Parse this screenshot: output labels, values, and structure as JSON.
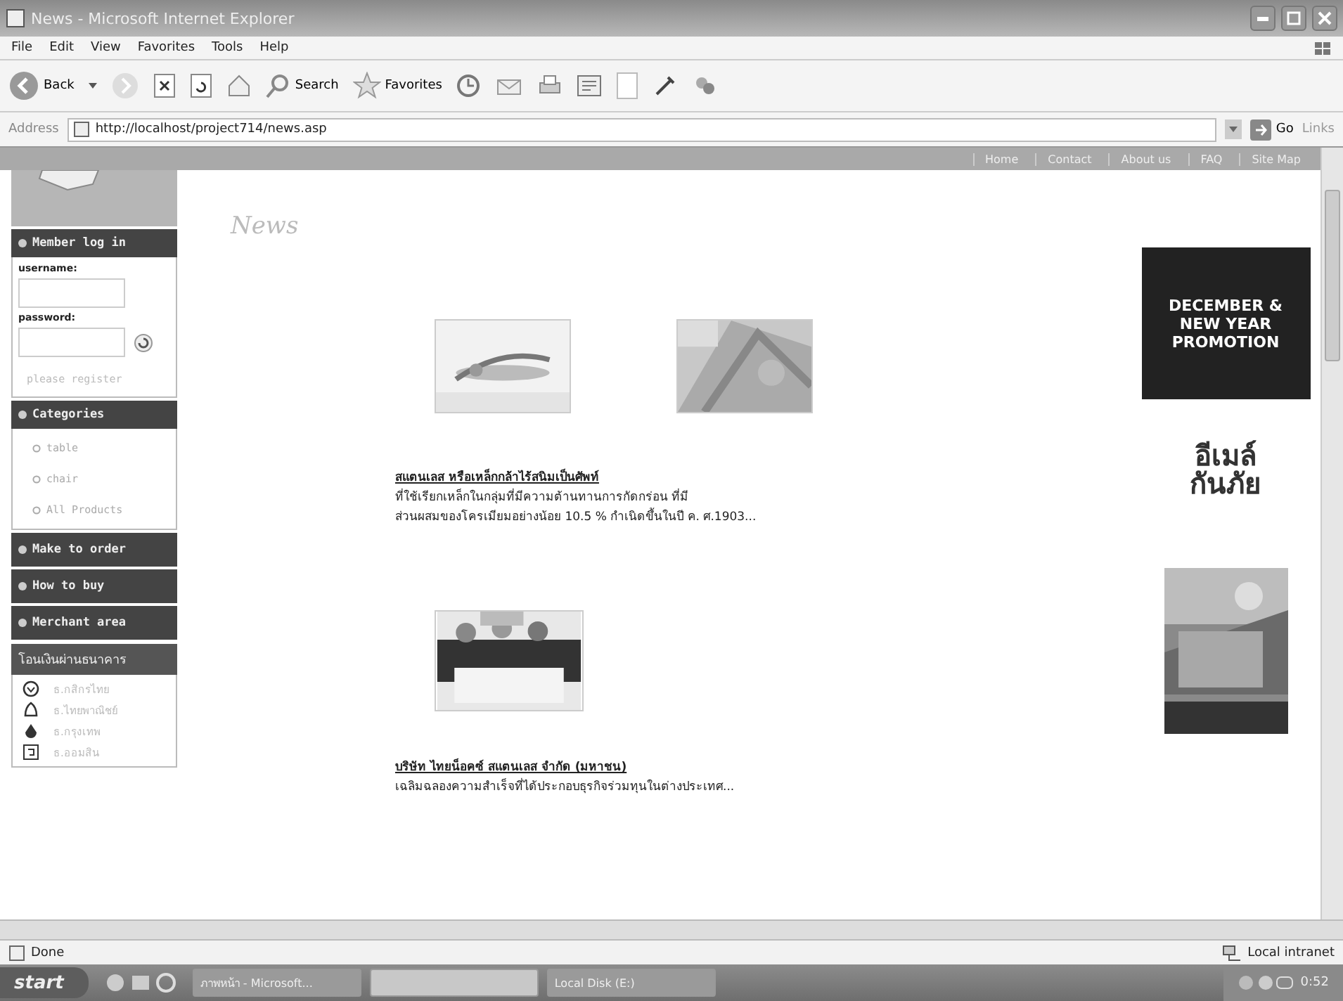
{
  "window": {
    "title": "News - Microsoft Internet Explorer"
  },
  "menu": [
    "File",
    "Edit",
    "View",
    "Favorites",
    "Tools",
    "Help"
  ],
  "toolbar": {
    "back": "Back",
    "search": "Search",
    "favorites": "Favorites"
  },
  "address": {
    "label": "Address",
    "url": "http://localhost/project714/news.asp",
    "go": "Go",
    "links": "Links"
  },
  "site_nav": [
    "Home",
    "Contact",
    "About us",
    "FAQ",
    "Site Map"
  ],
  "login": {
    "title": "Member log in",
    "username_label": "username:",
    "password_label": "password:",
    "register": "please register"
  },
  "categories": {
    "title": "Categories",
    "items": [
      "table",
      "chair",
      "All Products"
    ]
  },
  "menu_blocks": [
    "Make to order",
    "How to buy",
    "Merchant area"
  ],
  "bank": {
    "title": "โอนเงินผ่านธนาคาร",
    "items": [
      {
        "kind": "ring",
        "label": "ธ.กสิกรไทย"
      },
      {
        "kind": "bell",
        "label": "ธ.ไทยพาณิชย์"
      },
      {
        "kind": "drop",
        "label": "ธ.กรุงเทพ"
      },
      {
        "kind": "square",
        "label": "ธ.ออมสิน"
      }
    ]
  },
  "page_title": "News",
  "news": [
    {
      "photos": [
        {
          "kind": "picture"
        },
        {
          "kind": "picture"
        }
      ],
      "headline": "สแตนเลส หรือเหล็กกล้าไร้สนิมเป็นศัพท์",
      "lines": [
        "ที่ใช้เรียกเหล็กในกลุ่มที่มีความต้านทานการกัดกร่อน ที่มี",
        "ส่วนผสมของโครเมียมอย่างน้อย 10.5 % กำเนิดขึ้นในปี ค. ศ.1903..."
      ]
    },
    {
      "photos": [
        {
          "kind": "picture"
        }
      ],
      "headline": "บริษัท ไทยน็อคซ์ สแตนเลส จำกัด (มหาชน)",
      "lines": [
        "เฉลิมฉลองความสำเร็จที่ได้ประกอบธุรกิจร่วมทุนในต่างประเทศ..."
      ]
    }
  ],
  "ads": [
    {
      "kind": "promotion",
      "lines": [
        "DECEMBER &",
        "NEW YEAR",
        "PROMOTION"
      ]
    },
    {
      "kind": "logo",
      "lines": [
        "อีเมล์",
        "กันภัย"
      ]
    },
    {
      "kind": "picture"
    }
  ],
  "status_bar": {
    "text": "Done",
    "zone": "Local intranet"
  },
  "taskbar": {
    "start": "start",
    "tasks": [
      {
        "label": "ภาพหน้า - Microsoft...",
        "selected": false
      },
      {
        "selected": true
      },
      {
        "label": "Local Disk (E:)",
        "selected": false
      }
    ],
    "clock": "0:52"
  }
}
